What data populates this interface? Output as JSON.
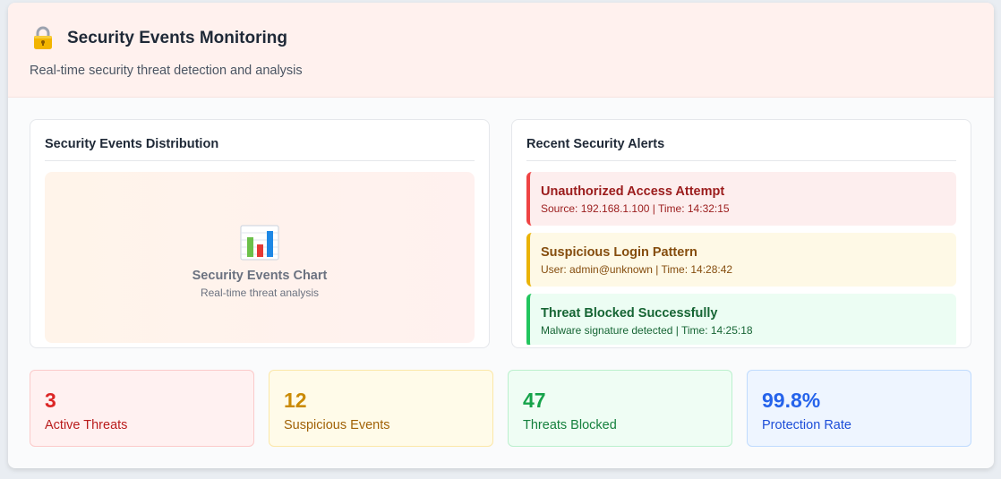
{
  "header": {
    "icon": "lock-icon",
    "title": "Security Events Monitoring",
    "subtitle": "Real-time security threat detection and analysis"
  },
  "distribution_panel": {
    "title": "Security Events Distribution",
    "icon": "bar-chart-icon",
    "chart_label": "Security Events Chart",
    "chart_sublabel": "Real-time threat analysis"
  },
  "alerts_panel": {
    "title": "Recent Security Alerts",
    "alerts": [
      {
        "title": "Unauthorized Access Attempt",
        "meta": "Source: 192.168.1.100 | Time: 14:32:15",
        "level": "red"
      },
      {
        "title": "Suspicious Login Pattern",
        "meta": "User: admin@unknown | Time: 14:28:42",
        "level": "yellow"
      },
      {
        "title": "Threat Blocked Successfully",
        "meta": "Malware signature detected | Time: 14:25:18",
        "level": "green"
      }
    ]
  },
  "stats": [
    {
      "value": "3",
      "label": "Active Threats",
      "color": "#dc2626"
    },
    {
      "value": "12",
      "label": "Suspicious Events",
      "color": "#ca8a04"
    },
    {
      "value": "47",
      "label": "Threats Blocked",
      "color": "#16a34a"
    },
    {
      "value": "99.8%",
      "label": "Protection Rate",
      "color": "#2563eb"
    }
  ],
  "colors": {
    "danger": "#ef4444",
    "warning": "#eab308",
    "success": "#22c55e",
    "info": "#2563eb"
  }
}
